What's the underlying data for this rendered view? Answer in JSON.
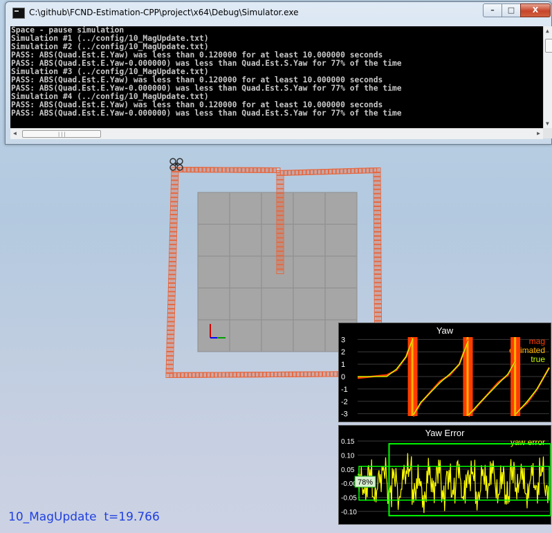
{
  "window": {
    "title": "C:\\github\\FCND-Estimation-CPP\\project\\x64\\Debug\\Simulator.exe",
    "minimize_label": "–",
    "maximize_label": "□",
    "close_label": "X"
  },
  "console": {
    "lines": [
      "Space - pause simulation",
      "Simulation #1 (../config/10_MagUpdate.txt)",
      "Simulation #2 (../config/10_MagUpdate.txt)",
      "PASS: ABS(Quad.Est.E.Yaw) was less than 0.120000 for at least 10.000000 seconds",
      "PASS: ABS(Quad.Est.E.Yaw-0.000000) was less than Quad.Est.S.Yaw for 77% of the time",
      "Simulation #3 (../config/10_MagUpdate.txt)",
      "PASS: ABS(Quad.Est.E.Yaw) was less than 0.120000 for at least 10.000000 seconds",
      "PASS: ABS(Quad.Est.E.Yaw-0.000000) was less than Quad.Est.S.Yaw for 77% of the time",
      "Simulation #4 (../config/10_MagUpdate.txt)",
      "PASS: ABS(Quad.Est.E.Yaw) was less than 0.120000 for at least 10.000000 seconds",
      "PASS: ABS(Quad.Est.E.Yaw-0.000000) was less than Quad.Est.S.Yaw for 77% of the time"
    ]
  },
  "status": {
    "scenario": "10_MagUpdate",
    "time_label": "t=19.766"
  },
  "colors": {
    "trajectory": "#e8643a",
    "floor": "#a6a6a6",
    "status_text": "#2040e0",
    "mag": "#ff3c00",
    "estimated": "#ffb400",
    "true": "#c8ff00",
    "yaw_error": "#ffff00",
    "pass_box": "#00ff00"
  },
  "chart_data": [
    {
      "type": "line",
      "title": "Yaw",
      "ylim": [
        -3.3,
        3.3
      ],
      "yticks": [
        "3",
        "2",
        "1",
        "0",
        "-1",
        "-2",
        "-3"
      ],
      "legend_position": "top-right",
      "series": [
        {
          "name": "mag",
          "color": "#ff3c00"
        },
        {
          "name": "estimated",
          "color": "#ffb400"
        },
        {
          "name": "true",
          "color": "#c8ff00"
        }
      ],
      "x": [
        0.0,
        1.0,
        2.0,
        3.0,
        4.0,
        5.0,
        5.7,
        5.75,
        6.5,
        7.5,
        8.5,
        9.5,
        10.5,
        11.4,
        11.45,
        12.5,
        13.5,
        14.5,
        15.5,
        16.3,
        16.35,
        17.5,
        18.5,
        19.766
      ],
      "y": [
        0.0,
        0.0,
        0.0,
        0.0,
        0.6,
        1.6,
        3.1,
        -3.1,
        -2.1,
        -1.3,
        -0.5,
        0.2,
        1.0,
        2.9,
        -3.1,
        -2.2,
        -1.4,
        -0.6,
        0.2,
        1.3,
        -3.0,
        -2.0,
        -1.0,
        0.7
      ]
    },
    {
      "type": "line",
      "title": "Yaw Error",
      "ylim": [
        -0.13,
        0.16
      ],
      "yticks": [
        "0.15",
        "0.10",
        "0.05",
        "-0.00",
        "-0.05",
        "-0.10"
      ],
      "legend_position": "top-right",
      "annotation": "78%",
      "series": [
        {
          "name": "yaw error",
          "color": "#ffff00"
        }
      ],
      "pass_band": [
        -0.06,
        0.06
      ],
      "x": [
        0,
        0.5,
        1,
        1.5,
        2,
        2.5,
        3,
        3.5,
        4,
        4.5,
        5,
        5.5,
        6,
        6.5,
        7,
        7.5,
        8,
        8.5,
        9,
        9.5,
        10,
        10.5,
        11,
        11.5,
        12,
        12.5,
        13,
        13.5,
        14,
        14.5,
        15,
        15.5,
        16,
        16.5,
        17,
        17.5,
        18,
        18.5,
        19,
        19.5
      ],
      "y": [
        0.02,
        -0.04,
        0.06,
        -0.07,
        0.03,
        0.08,
        -0.05,
        0.04,
        -0.09,
        0.05,
        0.09,
        -0.06,
        0.02,
        -0.1,
        0.07,
        -0.03,
        0.08,
        -0.08,
        0.04,
        -0.05,
        0.09,
        -0.07,
        0.03,
        0.06,
        -0.09,
        0.05,
        -0.02,
        0.08,
        -0.06,
        0.04,
        -0.08,
        0.07,
        -0.03,
        0.05,
        -0.07,
        0.06,
        -0.04,
        0.08,
        -0.05,
        0.02
      ]
    }
  ]
}
